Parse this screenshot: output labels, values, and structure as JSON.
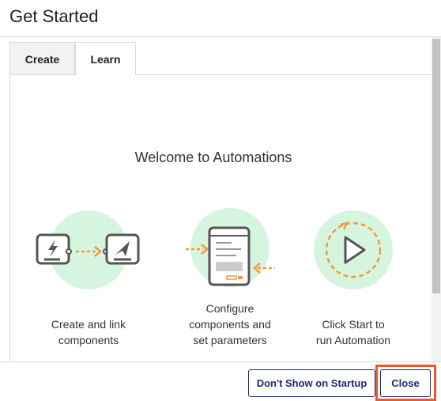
{
  "dialog": {
    "title": "Get Started"
  },
  "tabs": [
    {
      "label": "Create",
      "active": false
    },
    {
      "label": "Learn",
      "active": true
    }
  ],
  "learn": {
    "welcome": "Welcome to Automations",
    "steps": [
      {
        "icon": "link-components-icon",
        "caption_line1": "Create and link",
        "caption_line2": "components",
        "caption_line3": ""
      },
      {
        "icon": "configure-parameters-icon",
        "caption_line1": "Configure",
        "caption_line2": "components and",
        "caption_line3": "set parameters"
      },
      {
        "icon": "play-start-icon",
        "caption_line1": "Click Start to",
        "caption_line2": "run Automation",
        "caption_line3": ""
      }
    ]
  },
  "footer": {
    "dont_show_label": "Don't Show on Startup",
    "close_label": "Close"
  },
  "colors": {
    "accent_orange": "#f39a3c",
    "highlight_orange": "#ef5a24",
    "illustration_circle": "#d6f5df",
    "button_navy": "#1f2a7a",
    "icon_gray": "#555555"
  }
}
